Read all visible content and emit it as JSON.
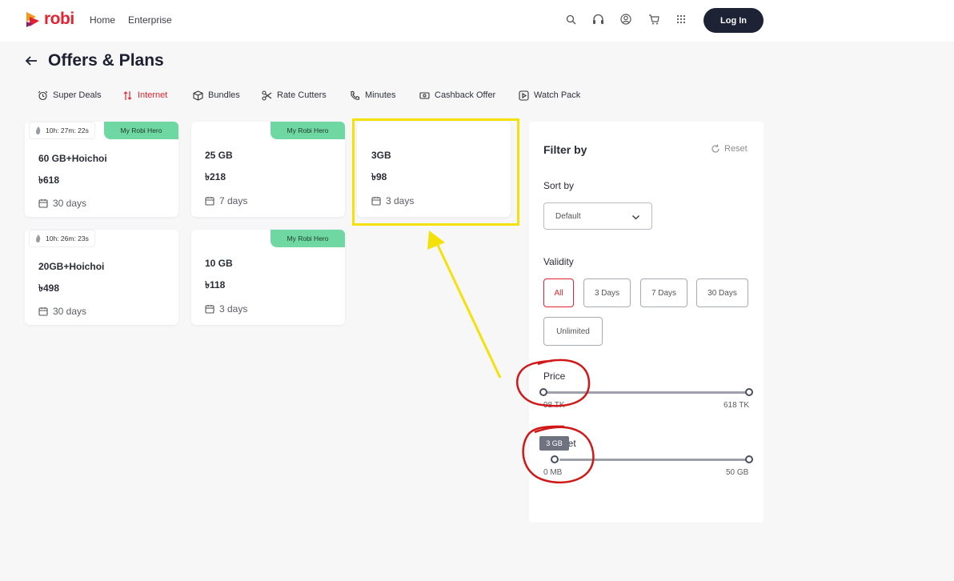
{
  "header": {
    "brand": "robi",
    "nav": [
      {
        "label": "Home"
      },
      {
        "label": "Enterprise"
      }
    ],
    "login_label": "Log In",
    "icons": [
      "search-icon",
      "headset-icon",
      "user-icon",
      "cart-icon",
      "apps-grid-icon"
    ]
  },
  "page": {
    "title": "Offers & Plans"
  },
  "tabs": [
    {
      "label": "Super Deals",
      "icon": "alarm-clock-icon",
      "active": false
    },
    {
      "label": "Internet",
      "icon": "signal-arrows-icon",
      "active": true
    },
    {
      "label": "Bundles",
      "icon": "box-icon",
      "active": false
    },
    {
      "label": "Rate Cutters",
      "icon": "scissors-icon",
      "active": false
    },
    {
      "label": "Minutes",
      "icon": "phone-icon",
      "active": false
    },
    {
      "label": "Cashback Offer",
      "icon": "cash-icon",
      "active": false
    },
    {
      "label": "Watch Pack",
      "icon": "play-icon",
      "active": false
    }
  ],
  "offers": [
    {
      "timer": "10h: 27m: 22s",
      "badge": "My Robi Hero",
      "name": "60 GB+Hoichoi",
      "price": "৳618",
      "validity": "30 days"
    },
    {
      "timer": "",
      "badge": "My Robi Hero",
      "name": "25 GB",
      "price": "৳218",
      "validity": "7 days"
    },
    {
      "timer": "",
      "badge": "",
      "name": "3GB",
      "price": "৳98",
      "validity": "3 days",
      "highlighted": true
    },
    {
      "timer": "10h: 26m: 23s",
      "badge": "",
      "name": "20GB+Hoichoi",
      "price": "৳498",
      "validity": "30 days"
    },
    {
      "timer": "",
      "badge": "My Robi Hero",
      "name": "10 GB",
      "price": "৳118",
      "validity": "3 days"
    }
  ],
  "filter": {
    "title": "Filter by",
    "reset_label": "Reset",
    "sort_label": "Sort by",
    "sort_value": "Default",
    "validity_label": "Validity",
    "validity_options": [
      "All",
      "3 Days",
      "7 Days",
      "30 Days",
      "Unlimited"
    ],
    "validity_selected": "All",
    "price_label": "Price",
    "price_min": "98 TK",
    "price_max": "618 TK",
    "internet_label": "Internet",
    "internet_min": "0 MB",
    "internet_max": "50 GB",
    "internet_tooltip": "3 GB",
    "internet_selected_fraction": 0.06
  },
  "colors": {
    "brand_red": "#e3232f",
    "hero_badge": "#6fd8a2",
    "login_bg": "#1d2234",
    "highlight_box": "#f5e10a",
    "annotation_circle": "#d01818"
  }
}
